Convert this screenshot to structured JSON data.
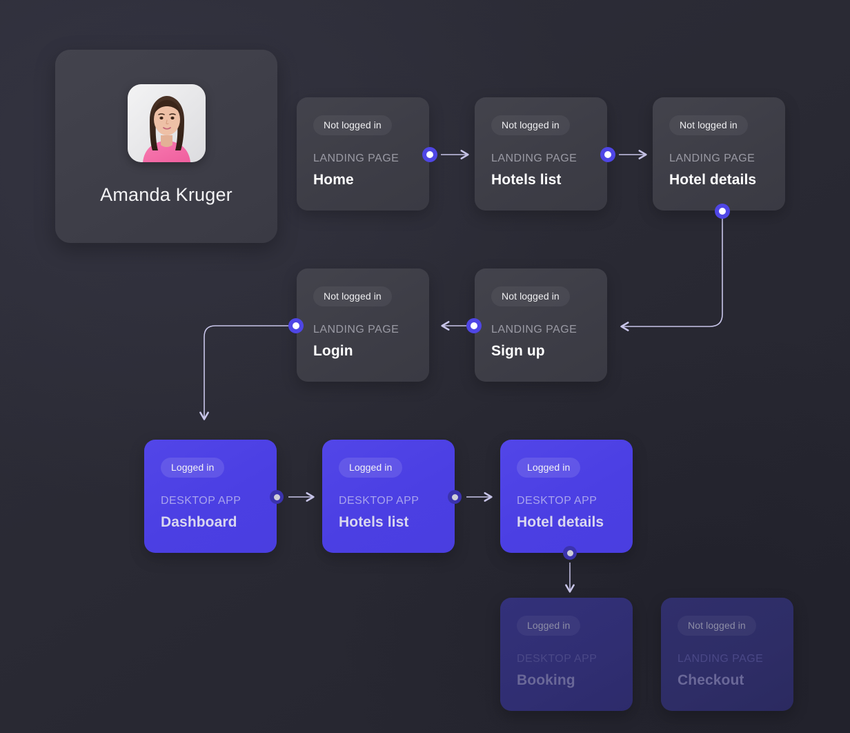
{
  "profile": {
    "name": "Amanda Kruger",
    "avatar_icon": "user-photo-avatar"
  },
  "flow": {
    "badges": {
      "not_logged_in": "Not logged in",
      "logged_in": "Logged in"
    },
    "kinds": {
      "landing": "LANDING PAGE",
      "desktop": "DESKTOP APP"
    },
    "nodes": [
      {
        "id": "home",
        "badge": "Not logged in",
        "kind": "LANDING PAGE",
        "title": "Home",
        "style": "dark"
      },
      {
        "id": "hotels-list",
        "badge": "Not logged in",
        "kind": "LANDING PAGE",
        "title": "Hotels list",
        "style": "dark"
      },
      {
        "id": "hotel-details",
        "badge": "Not logged in",
        "kind": "LANDING PAGE",
        "title": "Hotel details",
        "style": "dark"
      },
      {
        "id": "login",
        "badge": "Not logged in",
        "kind": "LANDING PAGE",
        "title": "Login",
        "style": "dark"
      },
      {
        "id": "sign-up",
        "badge": "Not logged in",
        "kind": "LANDING PAGE",
        "title": "Sign up",
        "style": "dark"
      },
      {
        "id": "dashboard",
        "badge": "Logged in",
        "kind": "DESKTOP APP",
        "title": "Dashboard",
        "style": "purple"
      },
      {
        "id": "app-hotels-list",
        "badge": "Logged in",
        "kind": "DESKTOP APP",
        "title": "Hotels list",
        "style": "purple"
      },
      {
        "id": "app-hotel-details",
        "badge": "Logged in",
        "kind": "DESKTOP APP",
        "title": "Hotel details",
        "style": "purple"
      },
      {
        "id": "booking",
        "badge": "Logged in",
        "kind": "DESKTOP APP",
        "title": "Booking",
        "style": "faded-purple"
      },
      {
        "id": "checkout",
        "badge": "Not logged in",
        "kind": "LANDING PAGE",
        "title": "Checkout",
        "style": "faded-dark"
      }
    ]
  },
  "colors": {
    "background": "#2a2a34",
    "card_dark": "#3e3e48",
    "card_purple": "#4b3fe3",
    "accent_dot": "#4f46e5",
    "connector_line": "#c9c6ea",
    "text_primary": "#ffffff",
    "text_muted": "#9a9aa4"
  }
}
